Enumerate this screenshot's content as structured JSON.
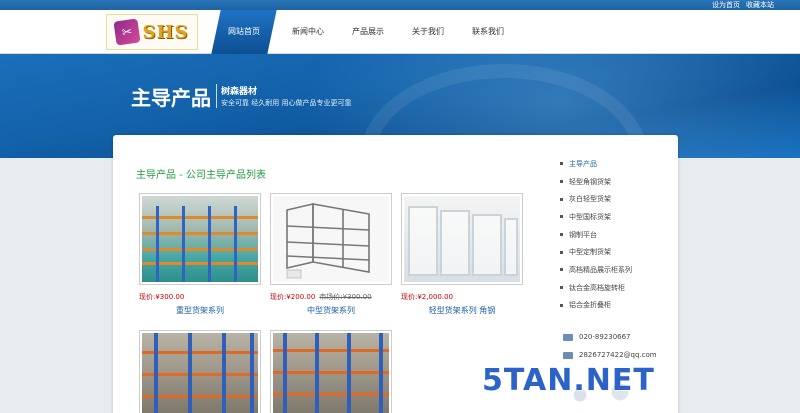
{
  "topbar": {
    "links": [
      "设为首页",
      "收藏本站"
    ]
  },
  "logo": {
    "text": "SHS"
  },
  "nav": {
    "items": [
      "网站首页",
      "新闻中心",
      "产品展示",
      "关于我们",
      "联系我们"
    ],
    "active_index": 0
  },
  "banner": {
    "title": "主导产品",
    "subtitle": "树森器材",
    "tagline": "安全可靠 经久耐用 用心做产品专业更可靠"
  },
  "section": {
    "title": "主导产品 - 公司主导产品列表"
  },
  "products": [
    {
      "price": "现价:¥300.00",
      "old_price": "",
      "name": "重型货架系列"
    },
    {
      "price": "现价:¥200.00",
      "old_price": "市场价:¥300.00",
      "name": "中型货架系列"
    },
    {
      "price": "现价:¥2,000.00",
      "old_price": "",
      "name": "轻型货架系列 角钢"
    }
  ],
  "sidebar": {
    "items": [
      "主导产品",
      "轻型角钢货架",
      "灰白轻型货架",
      "中型国标货架",
      "钢制平台",
      "中型定制货架",
      "高档精品展示柜系列",
      "钛合金高档旋转柜",
      "铝合金折叠柜"
    ],
    "active_index": 0
  },
  "contact": {
    "phone": "020-89230667",
    "email": "2826727422@qq.com"
  },
  "watermark": {
    "text": "5TAN.NET"
  }
}
